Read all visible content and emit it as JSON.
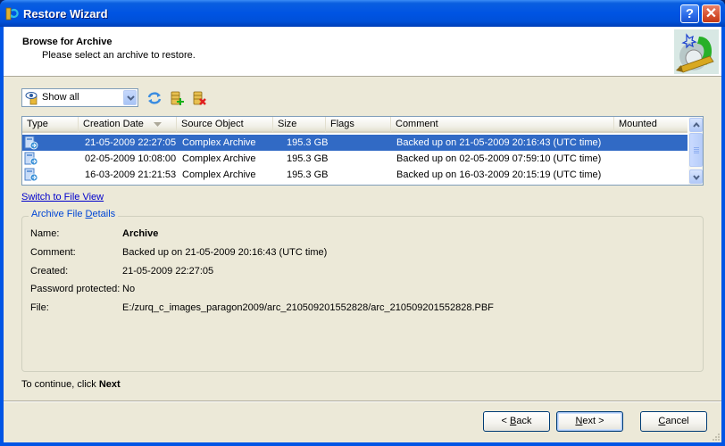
{
  "window": {
    "title": "Restore Wizard",
    "help_label": "?",
    "close_label": "✕"
  },
  "header": {
    "title": "Browse for Archive",
    "subtitle": "Please select an archive to restore."
  },
  "toolbar": {
    "filter": {
      "selected": "Show all"
    },
    "icons": [
      "refresh-icon",
      "add-archive-icon",
      "delete-archive-icon"
    ]
  },
  "archive_list": {
    "columns": [
      "Type",
      "Creation Date",
      "Source Object",
      "Size",
      "Flags",
      "Comment",
      "Mounted"
    ],
    "sort_column": "Creation Date",
    "rows": [
      {
        "type_icon": "archive-icon",
        "creation_date": "21-05-2009 22:27:05",
        "source_object": "Complex Archive",
        "size": "195.3 GB",
        "flags": "",
        "comment": "Backed up on 21-05-2009 20:16:43 (UTC time)",
        "mounted": "",
        "selected": true
      },
      {
        "type_icon": "archive-icon",
        "creation_date": "02-05-2009 10:08:00",
        "source_object": "Complex Archive",
        "size": "195.3 GB",
        "flags": "",
        "comment": "Backed up on 02-05-2009 07:59:10 (UTC time)",
        "mounted": "",
        "selected": false
      },
      {
        "type_icon": "archive-icon",
        "creation_date": "16-03-2009 21:21:53",
        "source_object": "Complex Archive",
        "size": "195.3 GB",
        "flags": "",
        "comment": "Backed up on 16-03-2009 20:15:19 (UTC time)",
        "mounted": "",
        "selected": false
      }
    ]
  },
  "switch_view_link": "Switch to File View",
  "details": {
    "legend_prefix": "Archive File ",
    "legend_accel": "D",
    "legend_suffix": "etails",
    "fields": [
      {
        "label": "Name:",
        "value": "Archive"
      },
      {
        "label": "Comment:",
        "value": "Backed up on 21-05-2009 20:16:43 (UTC time)"
      },
      {
        "label": "Created:",
        "value": "21-05-2009 22:27:05"
      },
      {
        "label": "Password protected:",
        "value": "No"
      },
      {
        "label": "File:",
        "value": "E:/zurq_c_images_paragon2009/arc_210509201552828/arc_210509201552828.PBF"
      }
    ]
  },
  "footer": {
    "hint_prefix": "To continue, click ",
    "hint_bold": "Next",
    "back": {
      "prefix": "< ",
      "accel": "B",
      "rest": "ack"
    },
    "next": {
      "accel": "N",
      "rest": "ext >"
    },
    "cancel": {
      "accel": "C",
      "rest": "ancel"
    }
  }
}
